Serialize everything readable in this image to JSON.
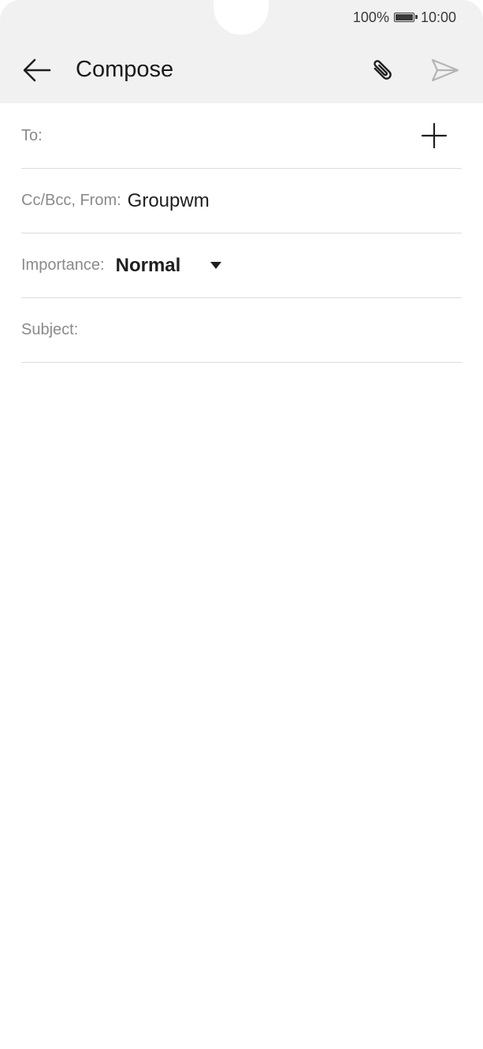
{
  "status_bar": {
    "battery_percent": "100%",
    "time": "10:00"
  },
  "toolbar": {
    "title": "Compose",
    "back_icon": "arrow-left-icon",
    "attach_icon": "paperclip-icon",
    "send_icon": "send-icon"
  },
  "form": {
    "to_label": "To:",
    "cc_label": "Cc/Bcc, From:",
    "from_value": "Groupwm",
    "importance_label": "Importance:",
    "importance_value": "Normal",
    "subject_label": "Subject:"
  },
  "colors": {
    "header_bg": "#f1f1f1",
    "divider": "#dcdcdc",
    "label_text": "#8a8a8a",
    "primary_text": "#1f1f1f",
    "send_disabled": "#b5b5b5"
  }
}
